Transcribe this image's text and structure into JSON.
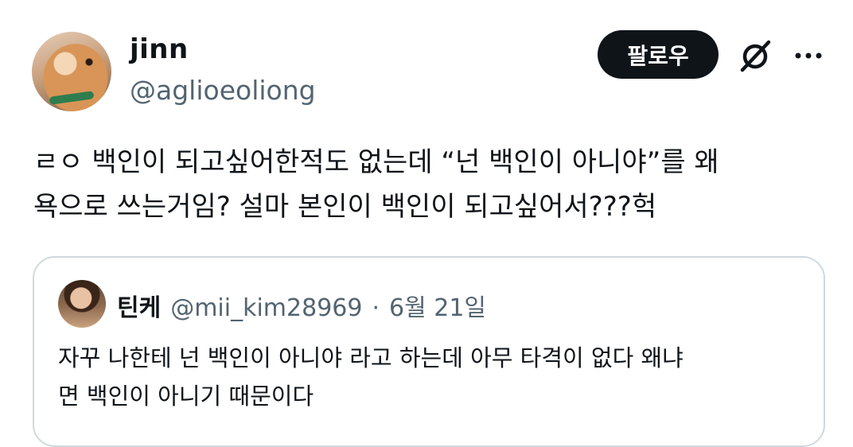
{
  "author": {
    "name": "jinn",
    "handle": "@aglioeoliong"
  },
  "actions": {
    "follow_label": "팔로우",
    "grok_icon": "grok-icon",
    "more_icon": "more-dots-icon"
  },
  "tweet": {
    "text": "ㄹㅇ 백인이 되고싶어한적도 없는데 “넌 백인이 아니야”를 왜\n욕으로 쓰는거임? 설마 본인이 백인이 되고싶어서???헉"
  },
  "quote": {
    "name": "틴케",
    "handle": "@mii_kim28969",
    "separator": "·",
    "date": "6월 21일",
    "text": "자꾸 나한테 넌 백인이 아니야 라고 하는데 아무 타격이 없다 왜냐\n면 백인이 아니기 때문이다"
  },
  "colors": {
    "text": "#0f1419",
    "secondary": "#536471",
    "button_bg": "#0f1419",
    "border": "#cfd9de"
  }
}
